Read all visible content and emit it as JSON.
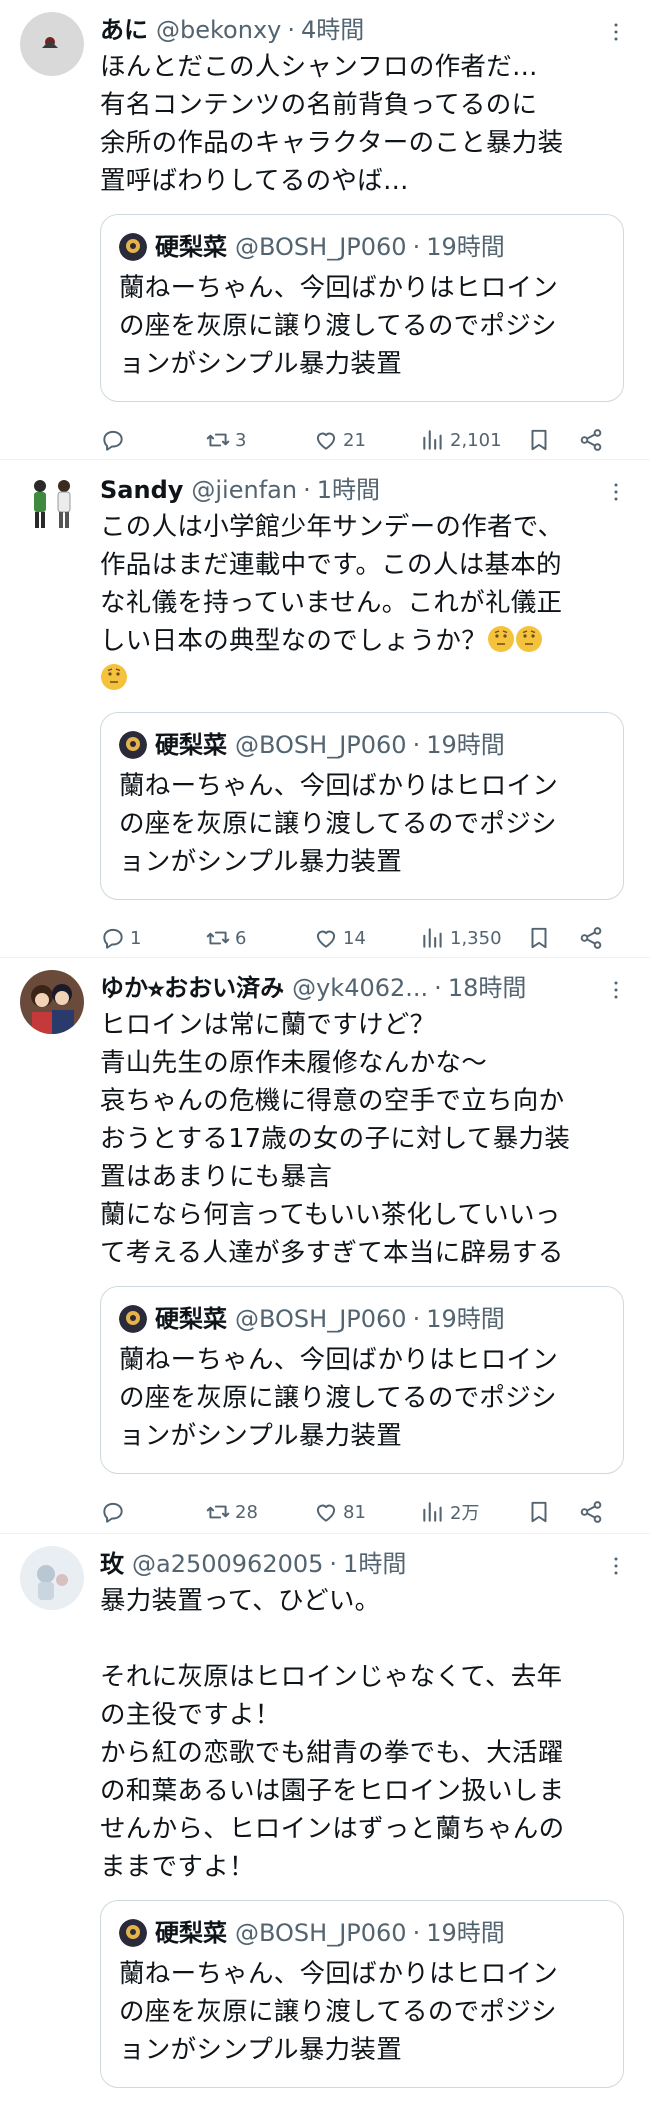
{
  "colors": {
    "text": "#0f1419",
    "secondary": "#536471",
    "border": "#cfd9de",
    "divider": "#eff3f4"
  },
  "quoted_tweet": {
    "name": "硬梨菜",
    "handle": "@BOSH_JP060",
    "dot": "·",
    "time": "19時間",
    "text": "蘭ねーちゃん、今回ばかりはヒロイン\nの座を灰原に譲り渡してるのでポジシ\nョンがシンプル暴力装置"
  },
  "tweets": [
    {
      "name": "あに",
      "handle": "@bekonxy",
      "dot": "·",
      "time": "4時間",
      "text": "ほんとだこの人シャンフロの作者だ…\n有名コンテンツの名前背負ってるのに\n余所の作品のキャラクターのこと暴力装\n置呼ばわりしてるのやば…",
      "counts": {
        "reply": "",
        "retweet": "3",
        "like": "21",
        "views": "2,101"
      },
      "icons": {
        "more": "more-dots-icon",
        "reply": "reply-icon",
        "retweet": "retweet-icon",
        "like": "heart-icon",
        "views": "views-icon",
        "bookmark": "bookmark-icon",
        "share": "share-icon"
      }
    },
    {
      "name": "Sandy",
      "handle": "@jienfan",
      "dot": "·",
      "time": "1時間",
      "text": "この人は小学館少年サンデーの作者で、\n作品はまだ連載中です。この人は基本的\nな礼儀を持っていません。これが礼儀正\nしい日本の典型なのでしょうか？",
      "emoji_count_line_end": "thinking-face-emoji",
      "counts": {
        "reply": "1",
        "retweet": "6",
        "like": "14",
        "views": "1,350"
      }
    },
    {
      "name": "ゆか⭐︎おおい済み",
      "handle": "@yk4062...",
      "dot": "·",
      "time": "18時間",
      "text": "ヒロインは常に蘭ですけど？\n青山先生の原作未履修なんかな〜\n哀ちゃんの危機に得意の空手で立ち向か\nおうとする17歳の女の子に対して暴力装\n置はあまりにも暴言\n蘭になら何言ってもいい茶化していいっ\nて考える人達が多すぎて本当に辟易する",
      "counts": {
        "reply": "",
        "retweet": "28",
        "like": "81",
        "views": "2万"
      }
    },
    {
      "name": "玫",
      "handle": "@a2500962005",
      "dot": "·",
      "time": "1時間",
      "text": "暴力装置って、ひどい。\n\nそれに灰原はヒロインじゃなくて、去年\nの主役ですよ！\nから紅の恋歌でも紺青の拳でも、大活躍\nの和葉あるいは園子をヒロイン扱いしま\nせんから、ヒロインはずっと蘭ちゃんの\nままですよ！",
      "counts": {
        "reply": "",
        "retweet": "",
        "like": "",
        "views": ""
      }
    }
  ]
}
